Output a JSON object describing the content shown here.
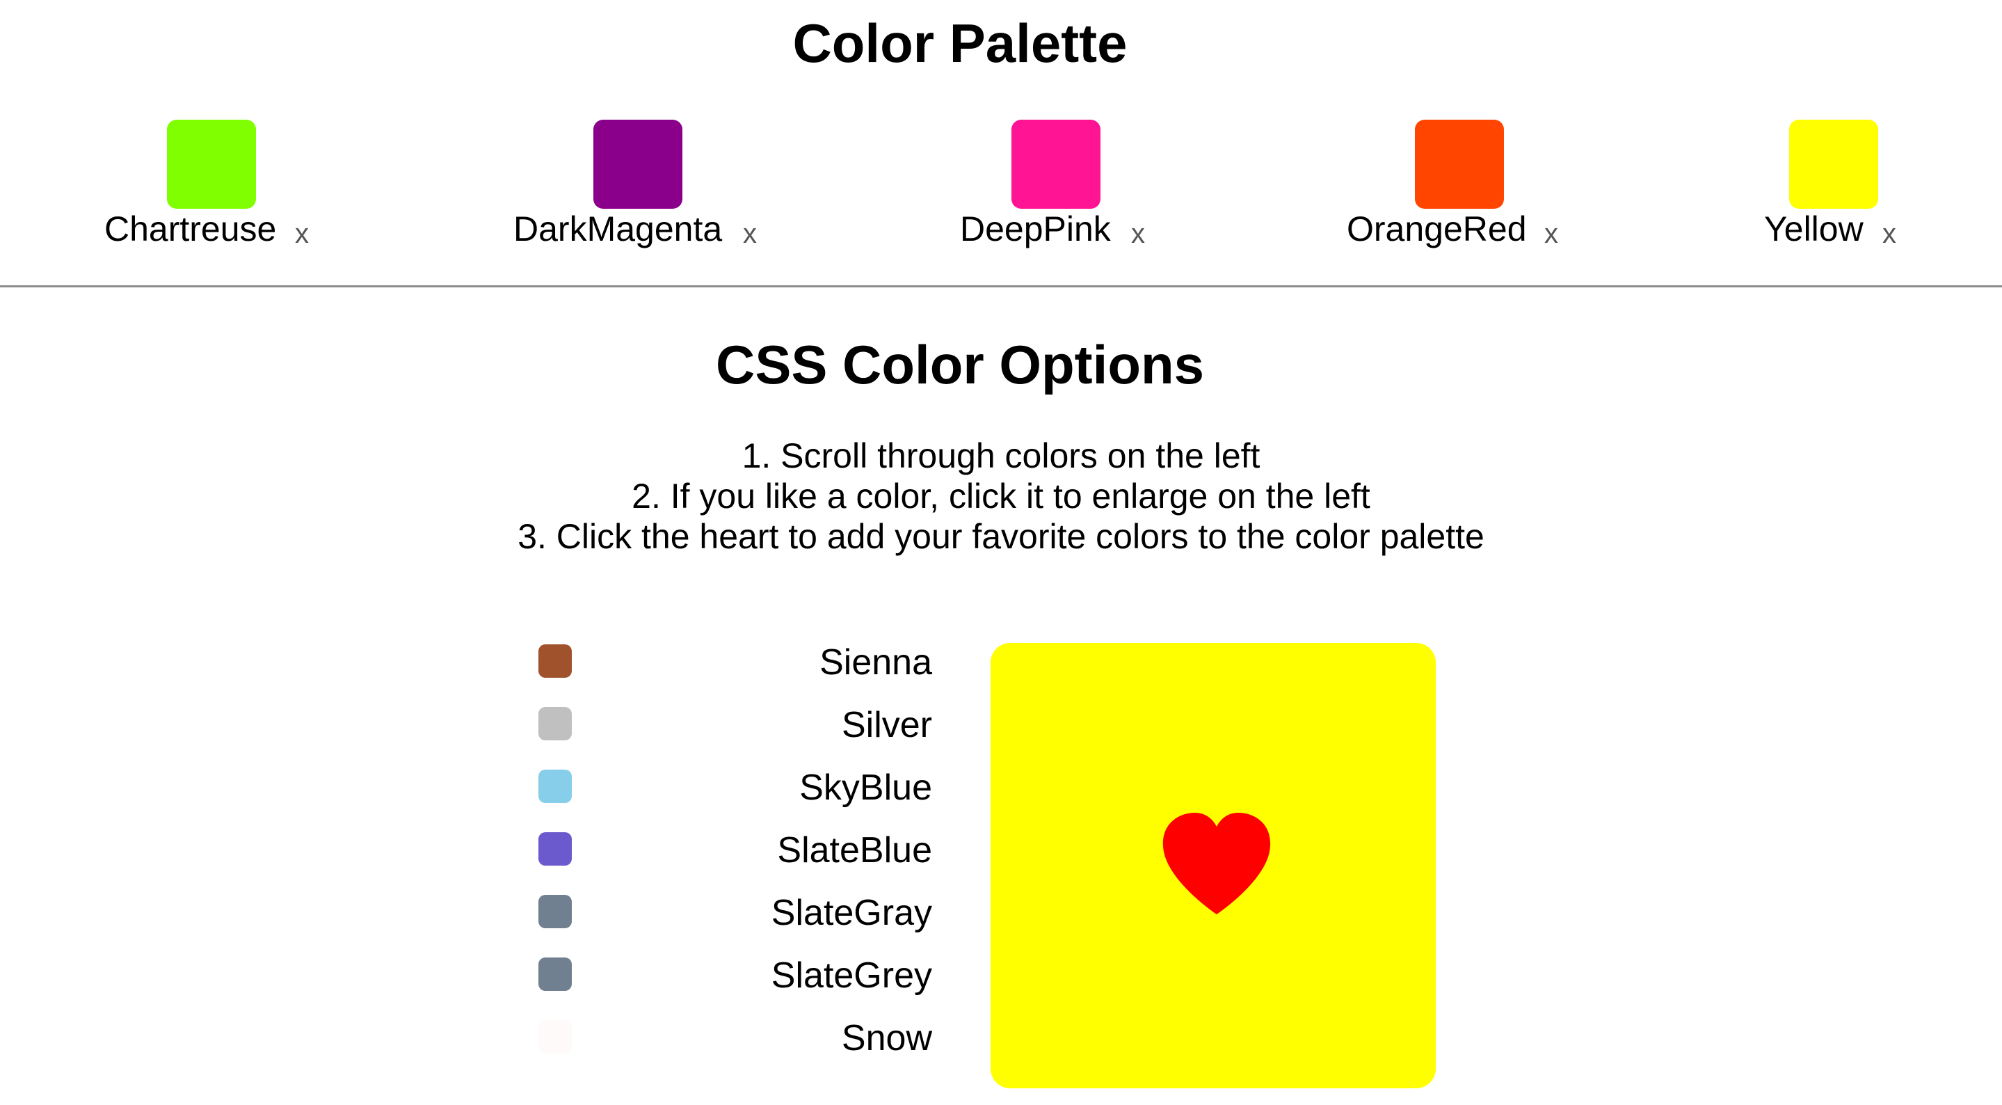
{
  "palette": {
    "title": "Color Palette",
    "remove_label": "x",
    "items": [
      {
        "name": "Chartreuse",
        "color": "#7FFF00"
      },
      {
        "name": "DarkMagenta",
        "color": "#8B008B"
      },
      {
        "name": "DeepPink",
        "color": "#FF1493"
      },
      {
        "name": "OrangeRed",
        "color": "#FF4500"
      },
      {
        "name": "Yellow",
        "color": "#FFFF00"
      }
    ]
  },
  "options": {
    "title": "CSS Color Options",
    "instructions": [
      "1. Scroll through colors on the left",
      "2. If you like a color, click it to enlarge on the left",
      "3. Click the heart to add your favorite colors to the color palette"
    ],
    "colors": [
      {
        "name": "Sienna",
        "color": "#A0522D"
      },
      {
        "name": "Silver",
        "color": "#C0C0C0"
      },
      {
        "name": "SkyBlue",
        "color": "#87CEEB"
      },
      {
        "name": "SlateBlue",
        "color": "#6A5ACD"
      },
      {
        "name": "SlateGray",
        "color": "#708090"
      },
      {
        "name": "SlateGrey",
        "color": "#708090"
      },
      {
        "name": "Snow",
        "color": "#FFFAFA"
      }
    ]
  },
  "preview": {
    "color": "#FFFF00",
    "heart_icon": "heart-icon",
    "heart_color": "#FF0000"
  }
}
